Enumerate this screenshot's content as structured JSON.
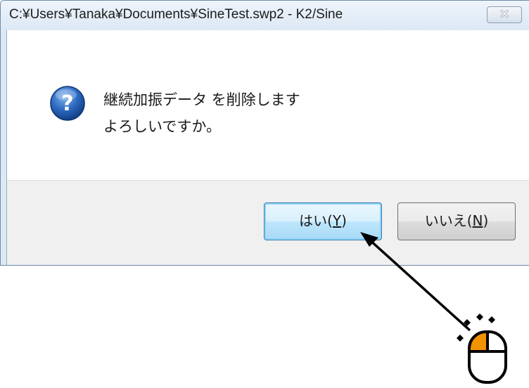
{
  "window": {
    "title": "C:¥Users¥Tanaka¥Documents¥SineTest.swp2 - K2/Sine",
    "close_icon": "close-icon"
  },
  "message": {
    "icon": "question-icon",
    "line1": "継続加振データ を削除します",
    "line2": "よろしいですか。"
  },
  "buttons": {
    "yes": {
      "label": "はい(",
      "mnemonic": "Y",
      "suffix": ")"
    },
    "no": {
      "label": "いいえ(",
      "mnemonic": "N",
      "suffix": ")"
    }
  },
  "annotation": {
    "arrow_target": "yes-button",
    "pointer_icon": "mouse-left-click-icon",
    "colors": {
      "arrow": "#000000",
      "mouse_button": "#f39200"
    }
  },
  "colors": {
    "title_bg": "#dce8f5",
    "button_area_bg": "#f0f0f0",
    "default_button_border": "#3c7fb1"
  }
}
